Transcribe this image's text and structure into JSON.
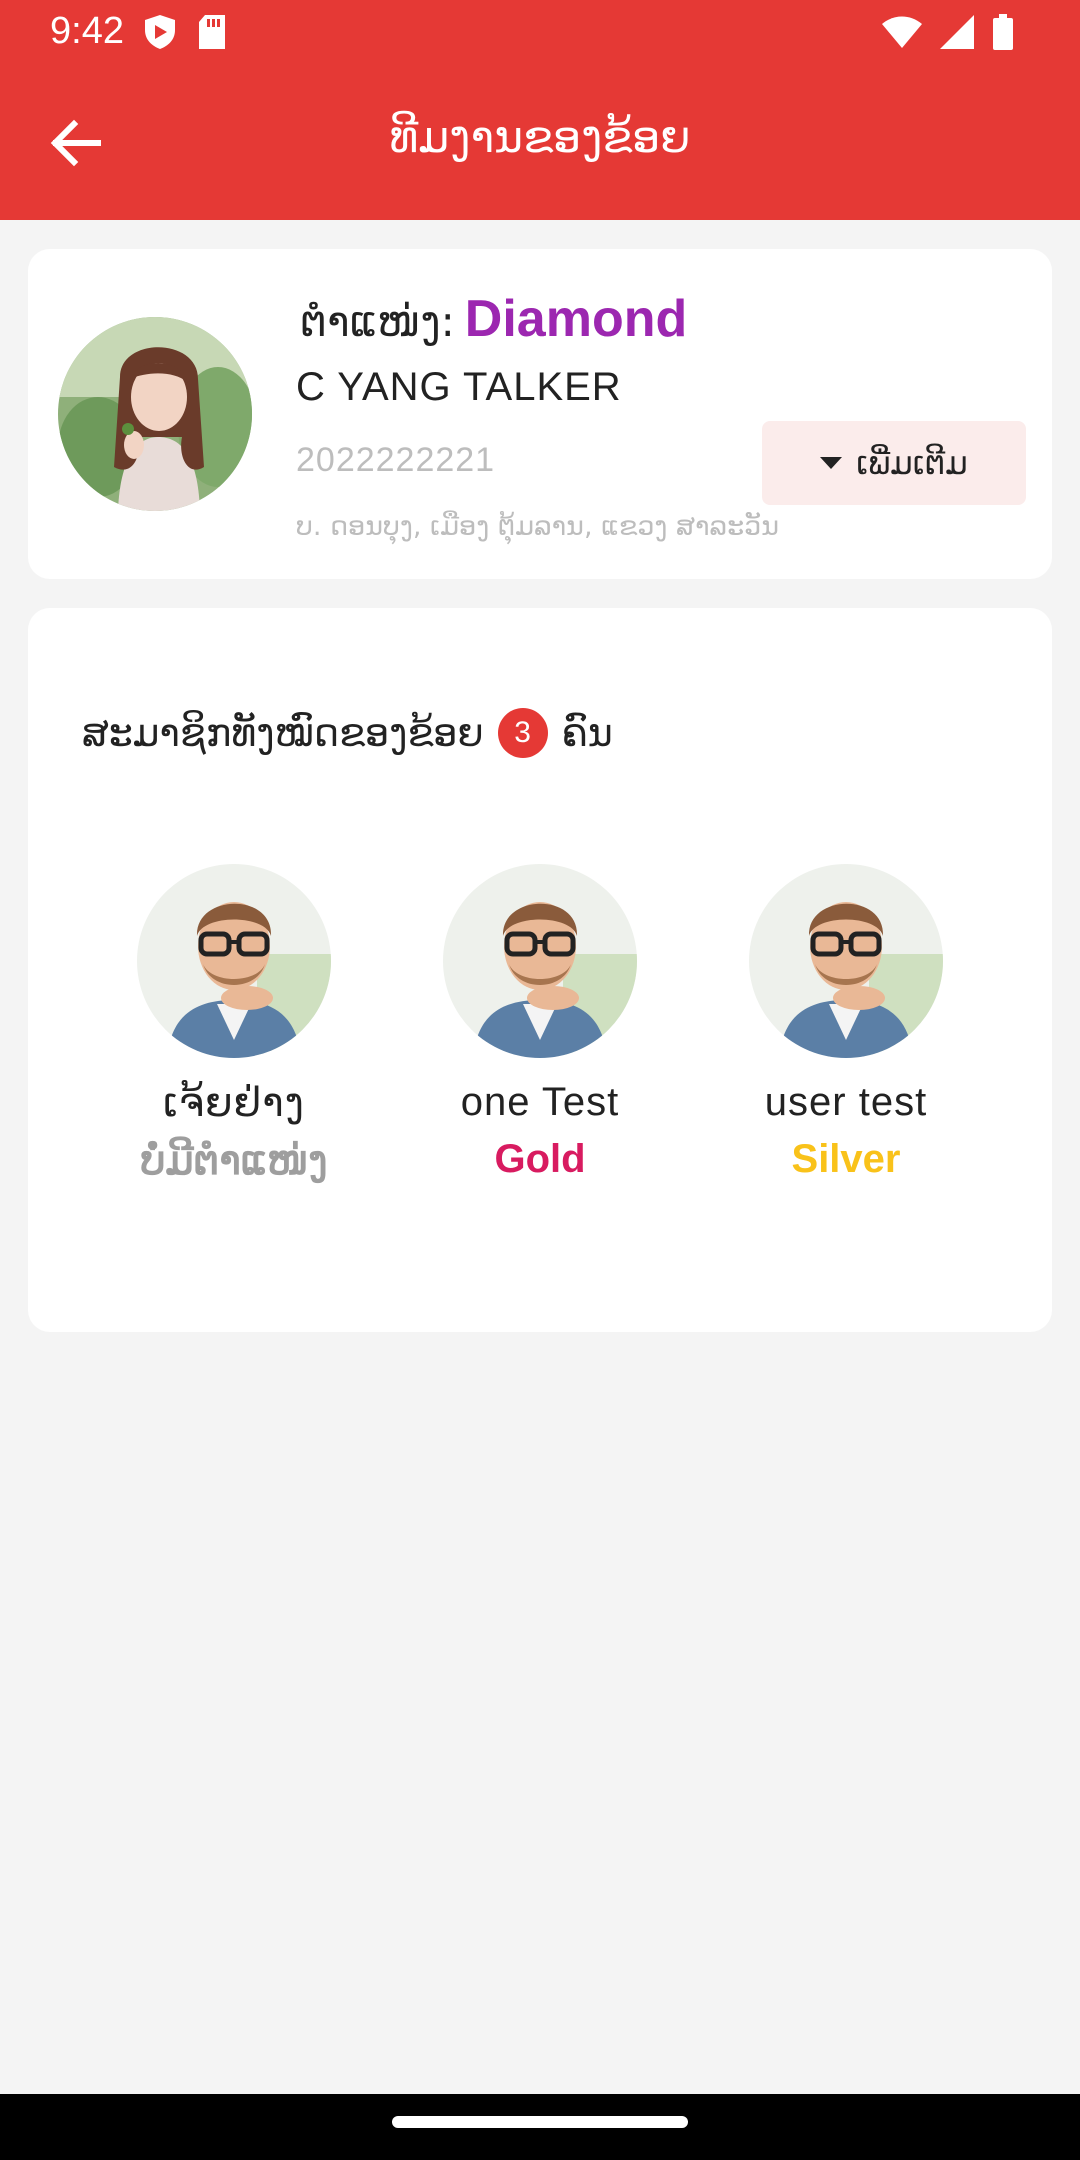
{
  "status_bar": {
    "time": "9:42",
    "icons": [
      "shield-icon",
      "sd-card-icon",
      "wifi-icon",
      "signal-icon",
      "battery-icon"
    ]
  },
  "app_bar": {
    "title": "ທີມງານຂອງຂ້ອຍ",
    "back_icon": "arrow-back-icon"
  },
  "profile": {
    "position_label": "ຕໍາແໜ່ງ:",
    "position_value": "Diamond",
    "position_color": "#9c27b0",
    "name": "C YANG TALKER",
    "phone": "2022222221",
    "address": "ບ. ດອນບຸງ, ເມືອງ ຕຸ້ມລານ, ແຂວງ ສາລະວັນ",
    "more_button": "ເພີ່ມເຕີມ"
  },
  "members": {
    "title": "ສະມາຊິກທັງໝົດຂອງຂ້ອຍ",
    "count": "3",
    "unit": "ຄົນ",
    "items": [
      {
        "name": "ເຈ້ຍຢ່າງ",
        "level": "ບໍ່ມີຕໍາແໜ່ງ",
        "level_color": "#9e9e9e"
      },
      {
        "name": "one Test",
        "level": "Gold",
        "level_color": "#d81b60"
      },
      {
        "name": "user test",
        "level": "Silver",
        "level_color": "#f9c21a"
      }
    ]
  },
  "colors": {
    "primary": "#e53935",
    "background": "#f4f4f4"
  }
}
